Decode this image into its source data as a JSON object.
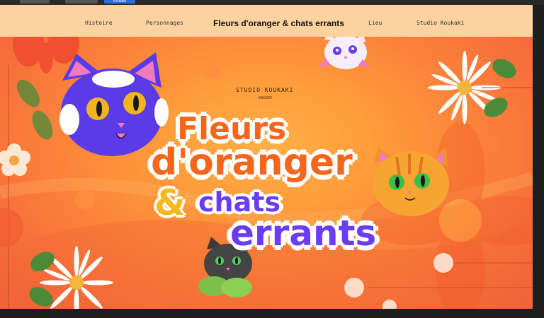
{
  "browser": {
    "tab_labels": [
      "",
      "",
      "Koukaki"
    ]
  },
  "nav": {
    "items": [
      "Histoire",
      "Personnages",
      "Lieu",
      "Studio Koukaki"
    ],
    "brand": "Fleurs d'oranger & chats errants"
  },
  "hero": {
    "studio": "STUDIO KOUKAKI",
    "presente": "PRÉSENTE",
    "title_line1": "Fleurs",
    "title_line2": "d'oranger",
    "title_amp": "&",
    "title_line3": "chats",
    "title_line4": "errants"
  },
  "colors": {
    "nav_bg": "#fcd3a0",
    "title_orange": "#f4661c",
    "title_purple": "#6b3cf2",
    "amp_yellow": "#f5b81e",
    "hero_orange": "#fa7a3a"
  }
}
